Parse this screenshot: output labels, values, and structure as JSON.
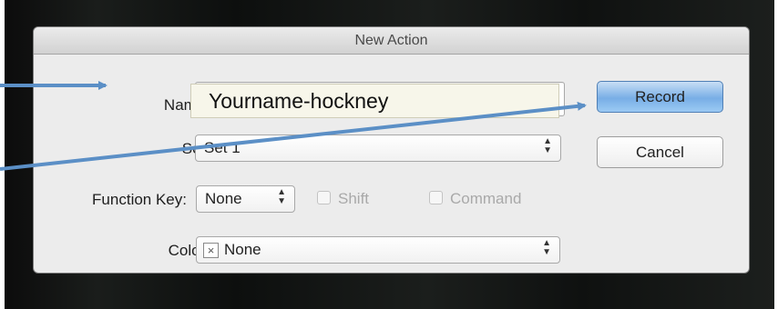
{
  "dialog": {
    "title": "New Action",
    "name_label": "Name:",
    "name_value": "Yourname-hockney",
    "set_label": "Set:",
    "set_value": "Set 1",
    "function_key_label": "Function Key:",
    "function_key_value": "None",
    "shift_label": "Shift",
    "command_label": "Command",
    "color_label": "Color:",
    "color_value": "None",
    "record_label": "Record",
    "cancel_label": "Cancel"
  },
  "colors": {
    "annotation_arrow": "#5b8fc6",
    "default_button": "#78aee6"
  },
  "icons": {
    "select_arrows": "updown-chevron-icon",
    "color_none": "x-box-icon"
  }
}
